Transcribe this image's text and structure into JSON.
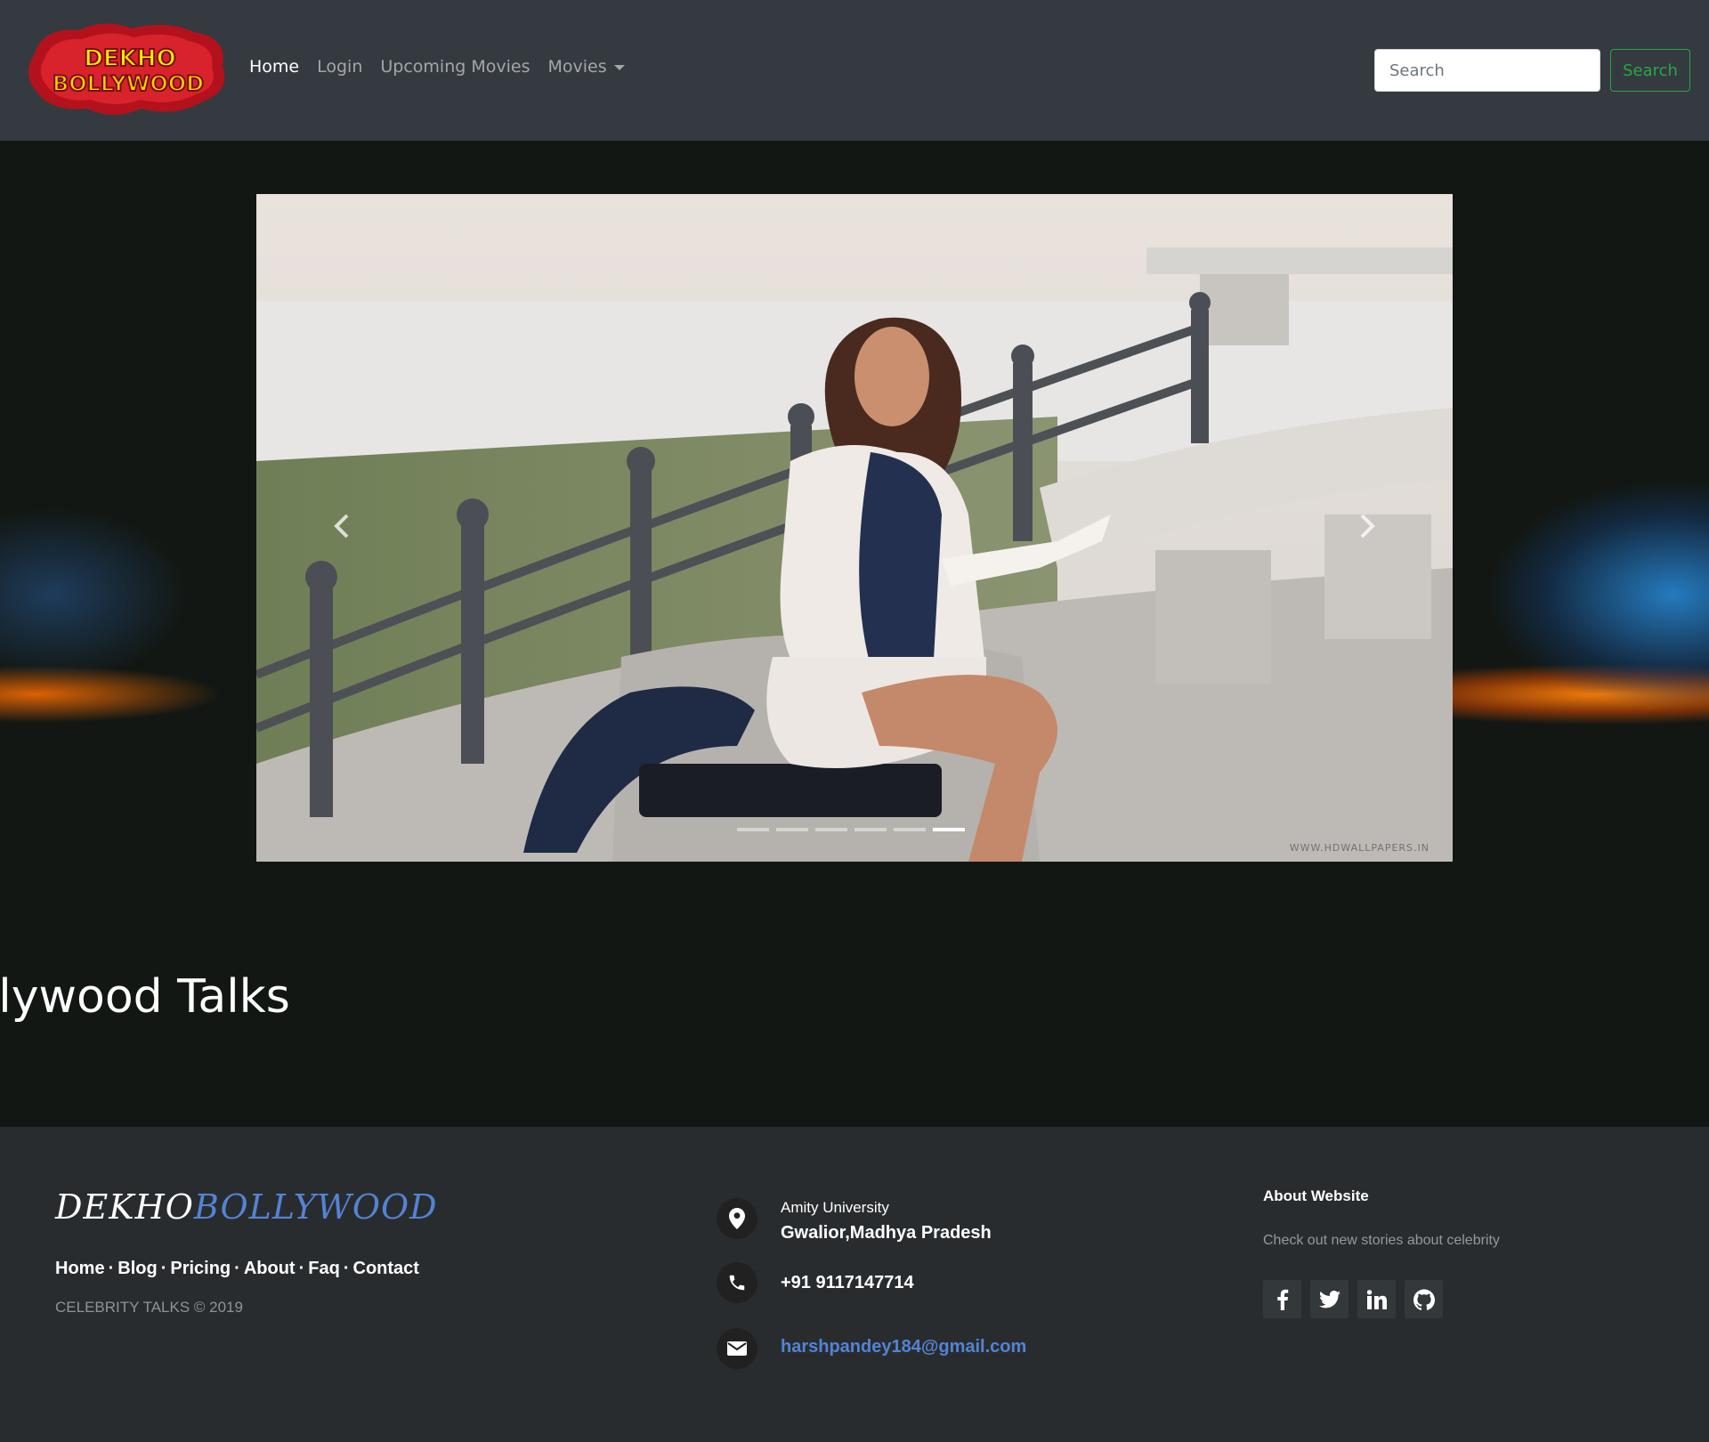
{
  "navbar": {
    "logo_text_top": "DEKHO",
    "logo_text_bottom": "BOLLYWOOD",
    "links": [
      {
        "label": "Home",
        "active": true
      },
      {
        "label": "Login",
        "active": false
      },
      {
        "label": "Upcoming Movies",
        "active": false
      },
      {
        "label": "Movies",
        "active": false,
        "dropdown": true
      }
    ],
    "search_placeholder": "Search",
    "search_button": "Search"
  },
  "hero": {
    "watermark": "WWW.HDWALLPAPERS.IN",
    "title": "ollywood Talks",
    "carousel": {
      "slide_count": 6,
      "active_index": 5,
      "prev_icon": "chevron-left-icon",
      "next_icon": "chevron-right-icon"
    }
  },
  "footer": {
    "brand_part1": "DEKHO",
    "brand_part2": "BOLLYWOOD",
    "links": [
      "Home",
      "Blog",
      "Pricing",
      "About",
      "Faq",
      "Contact"
    ],
    "copyright": "CELEBRITY TALKS © 2019",
    "address_line1": "Amity University",
    "address_line2": "Gwalior,Madhya Pradesh",
    "phone": "+91 9117147714",
    "email": "harshpandey184@gmail.com",
    "about_title": "About Website",
    "about_text": "Check out new stories about celebrity",
    "socials": [
      "facebook-icon",
      "twitter-icon",
      "linkedin-icon",
      "github-icon"
    ]
  },
  "colors": {
    "navbar_bg": "#343a40",
    "hero_bg": "#121713",
    "footer_bg": "#292c2f",
    "accent_blue": "#5383d3",
    "search_green": "#28a745"
  }
}
